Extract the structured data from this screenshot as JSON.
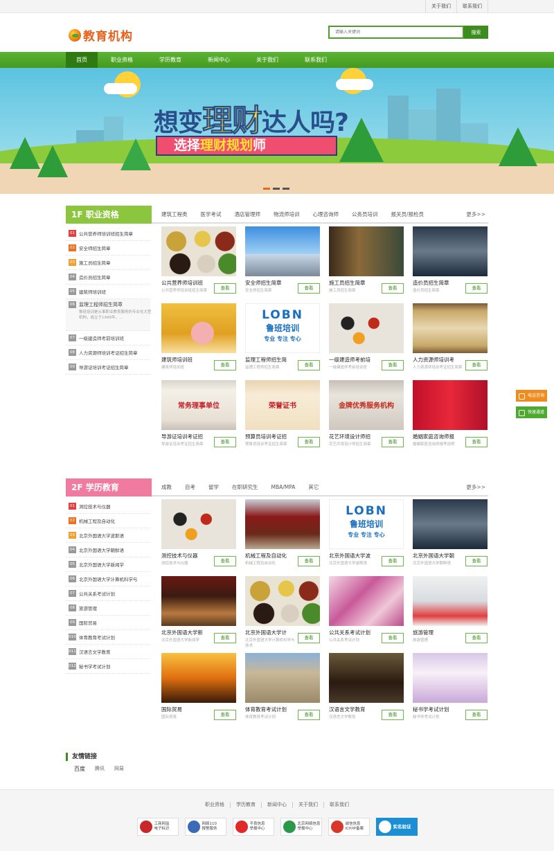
{
  "topbar": {
    "links": [
      "关于我们",
      "联系我们"
    ]
  },
  "header": {
    "logo_text": "教育机构",
    "search_placeholder": "请输入关键词",
    "search_button": "搜索"
  },
  "nav": {
    "items": [
      "首页",
      "职业资格",
      "学历教育",
      "新闻中心",
      "关于我们",
      "联系我们"
    ]
  },
  "banner": {
    "line1_a": "想变",
    "line1_b": "理财",
    "line1_c": "达人吗?",
    "line2_a": "选择",
    "line2_b": "理财规划",
    "line2_c": "师"
  },
  "floor1": {
    "tag": "1F 职业资格",
    "tag_color": "#8cc63f",
    "tabs": [
      "建筑工程类",
      "医学考试",
      "酒店管理师",
      "物流师培训",
      "心理咨询师",
      "公务员培训",
      "报关员/报检员"
    ],
    "more": "更多>>",
    "list": [
      {
        "num": "01",
        "text": "公共营养师培训班招生简章"
      },
      {
        "num": "02",
        "text": "安全师招生简章"
      },
      {
        "num": "03",
        "text": "施工员招生简章"
      },
      {
        "num": "04",
        "text": "造价员招生简章"
      },
      {
        "num": "05",
        "text": "建筑师培训班"
      },
      {
        "num": "06",
        "text": "监理工程师招生简章",
        "desc": "鲁班培训是从事职业教育服务的专业化大型机构，成立于1999年，..."
      },
      {
        "num": "07",
        "text": "一级建造师考前培训班"
      },
      {
        "num": "08",
        "text": "人力资源师培训考证招生简章"
      },
      {
        "num": "09",
        "text": "导游证培训考证招生简章"
      }
    ],
    "cards": [
      {
        "title": "公共营养师培训班",
        "sub": "公共营养师培训班招生简章",
        "btn": "查看"
      },
      {
        "title": "安全师招生简章",
        "sub": "安全师招生简章",
        "btn": "查看"
      },
      {
        "title": "施工员招生简章",
        "sub": "施工员招生简章",
        "btn": "查看"
      },
      {
        "title": "造价员招生简章",
        "sub": "造价员招生简章",
        "btn": "查看"
      },
      {
        "title": "建筑师培训班",
        "sub": "建筑师培训班",
        "btn": "查看"
      },
      {
        "title": "监理工程师招生简",
        "sub": "监理工程师招生简章",
        "btn": "查看"
      },
      {
        "title": "一级建造师考前培",
        "sub": "一级建造师考前培训班",
        "btn": "查看"
      },
      {
        "title": "人力资源师培训考",
        "sub": "人力资源师培训考证招生简章",
        "btn": "查看"
      },
      {
        "title": "导游证培训考证招",
        "sub": "导游证培训考证招生简章",
        "btn": "查看"
      },
      {
        "title": "预算员培训考证招",
        "sub": "预算员培训考证招生简章",
        "btn": "查看"
      },
      {
        "title": "花艺环境设计师招",
        "sub": "花艺环境设计师招生简章",
        "btn": "查看"
      },
      {
        "title": "婚姻家庭咨询师报",
        "sub": "婚姻家庭咨询师报考说明",
        "btn": "查看"
      }
    ],
    "cert_texts": [
      "常务理事单位",
      "荣誉证书",
      "金牌优秀服务机构",
      "LOBN",
      "鲁班培训",
      "专业 专注 专心"
    ]
  },
  "floor2": {
    "tag": "2F 学历教育",
    "tag_color": "#f07aa0",
    "tabs": [
      "成教",
      "自考",
      "留学",
      "在职研究生",
      "MBA/MPA",
      "其它"
    ],
    "more": "更多>>",
    "list": [
      {
        "num": "01",
        "text": "测控技术与仪器"
      },
      {
        "num": "02",
        "text": "机械工程及自动化"
      },
      {
        "num": "03",
        "text": "北京外国语大学波斯语"
      },
      {
        "num": "04",
        "text": "北京外国语大学朝鲜语"
      },
      {
        "num": "05",
        "text": "北京外国语大学新闻学"
      },
      {
        "num": "06",
        "text": "北京外国语大学计算机科学与"
      },
      {
        "num": "07",
        "text": "公共关系考试计划"
      },
      {
        "num": "08",
        "text": "旅游管理"
      },
      {
        "num": "09",
        "text": "国际贸易"
      },
      {
        "num": "010",
        "text": "体育教育考试计划"
      },
      {
        "num": "011",
        "text": "汉语言文学教育"
      },
      {
        "num": "012",
        "text": "秘书学考试计划"
      }
    ],
    "cards": [
      {
        "title": "测控技术与仪器",
        "sub": "测控技术与仪器",
        "btn": "查看"
      },
      {
        "title": "机械工程及自动化",
        "sub": "机械工程及自动化",
        "btn": "查看"
      },
      {
        "title": "北京外国语大学波",
        "sub": "北京外国语大学波斯语",
        "btn": "查看"
      },
      {
        "title": "北京外国语大学朝",
        "sub": "北京外国语大学朝鲜语",
        "btn": "查看"
      },
      {
        "title": "北京外国语大学新",
        "sub": "北京外国语大学新闻学",
        "btn": "查看"
      },
      {
        "title": "北京外国语大学计",
        "sub": "北京外国语大学计算机科学与技术",
        "btn": "查看"
      },
      {
        "title": "公共关系考试计划",
        "sub": "公共关系考试计划",
        "btn": "查看"
      },
      {
        "title": "旅游管理",
        "sub": "旅游管理",
        "btn": "查看"
      },
      {
        "title": "国际贸易",
        "sub": "国际贸易",
        "btn": "查看"
      },
      {
        "title": "体育教育考试计划",
        "sub": "体育教育考试计划",
        "btn": "查看"
      },
      {
        "title": "汉语言文学教育",
        "sub": "汉语言文学教育",
        "btn": "查看"
      },
      {
        "title": "秘书学考试计划",
        "sub": "秘书学考试计划",
        "btn": "查看"
      }
    ]
  },
  "friend_links": {
    "title": "友情链接",
    "items": [
      "百度",
      "腾讯",
      "网易"
    ]
  },
  "footer": {
    "nav": [
      "职业资格",
      "学历教育",
      "新闻中心",
      "关于我们",
      "联系我们"
    ],
    "badges": [
      {
        "line1": "工商网监",
        "line2": "电子标识"
      },
      {
        "line1": "网络110",
        "line2": "报警服务"
      },
      {
        "line1": "不良信息",
        "line2": "举报中心"
      },
      {
        "line1": "北京网络信息",
        "line2": "举报中心"
      },
      {
        "line1": "诚信信息",
        "line2": "ICP/IP备案"
      },
      {
        "line1": "实名验证",
        "line2": ""
      }
    ]
  },
  "side": {
    "phone": "电话咨询",
    "quick": "快速通道"
  },
  "colors": {
    "green": "#4c9c2e",
    "nav_active": "#2f7b12",
    "orange": "#f08c1e"
  }
}
